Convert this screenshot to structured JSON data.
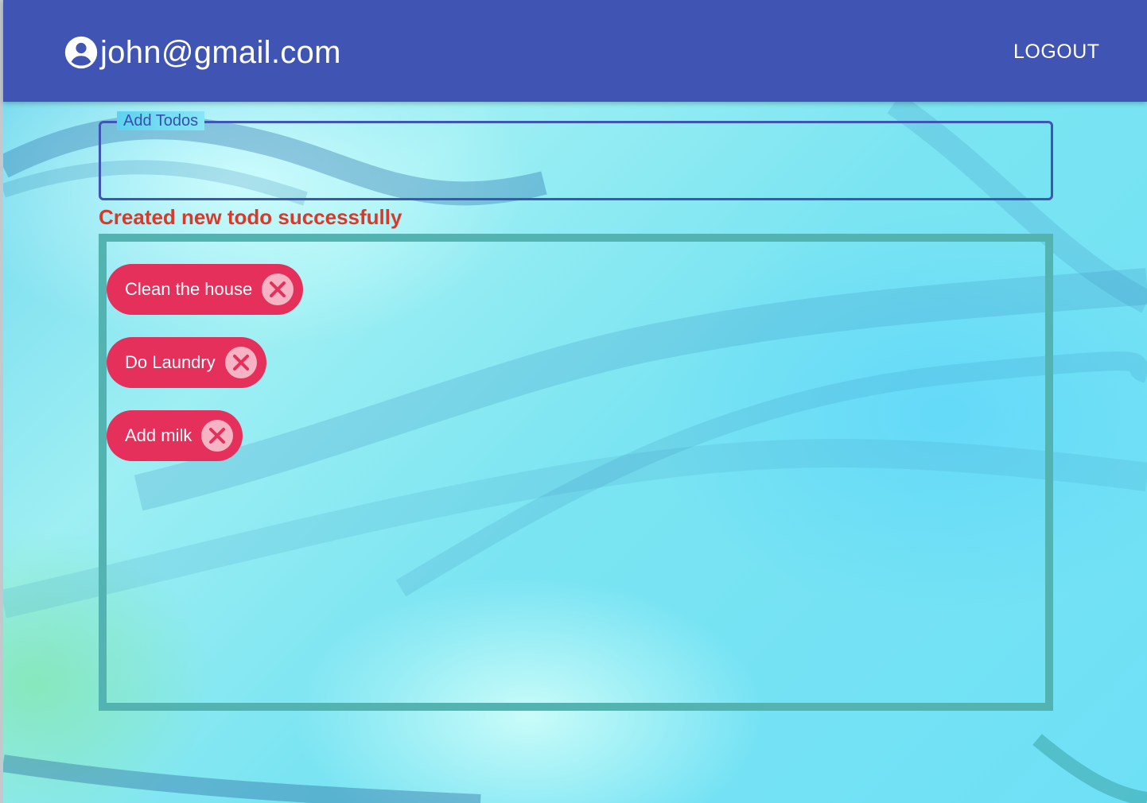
{
  "header": {
    "user_email": "john@gmail.com",
    "user_icon": "account-circle-icon",
    "logout_label": "LOGOUT",
    "background_color": "#4054b4"
  },
  "add_todo": {
    "label": "Add Todos",
    "value": ""
  },
  "status_message": "Created new todo successfully",
  "todos": [
    {
      "label": "Clean the house",
      "remove_icon": "cancel-circle-icon"
    },
    {
      "label": "Do Laundry",
      "remove_icon": "cancel-circle-icon"
    },
    {
      "label": "Add milk",
      "remove_icon": "cancel-circle-icon"
    }
  ],
  "colors": {
    "status_text": "#d9392a",
    "chip": "#e5305b",
    "list_border": "#53b3b0",
    "input_border": "#4054b4"
  }
}
